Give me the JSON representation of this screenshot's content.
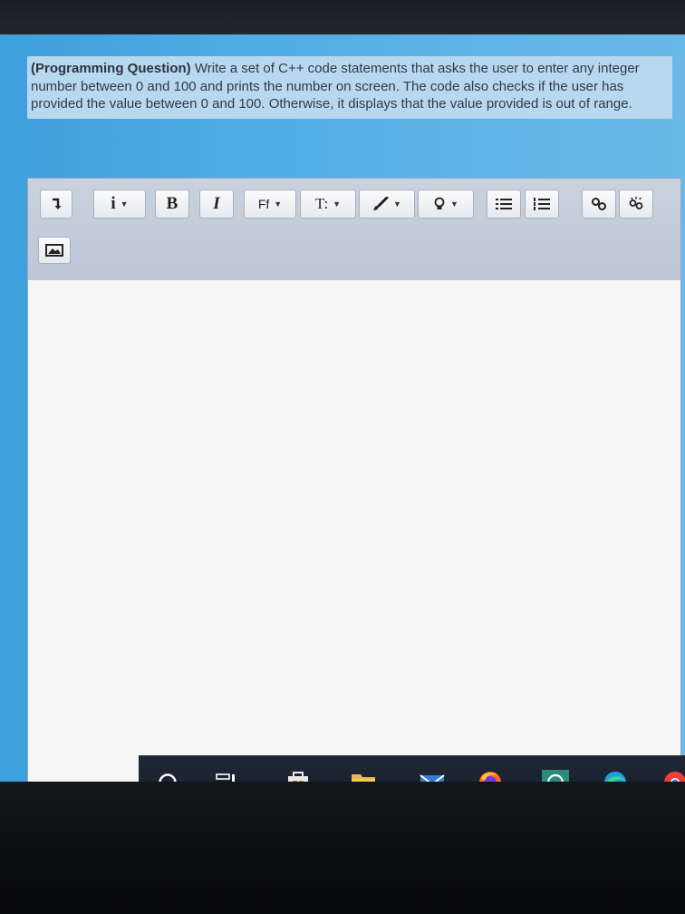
{
  "question": {
    "lead": "(Programming Question)",
    "text": " Write a set of C++ code statements that asks the user to enter any integer number between 0 and 100 and prints the number on screen. The code also checks if the user has provided the value between 0 and 100. Otherwise, it displays that the value provided is out of range."
  },
  "toolbar": {
    "paragraph_label": "i",
    "bold_label": "B",
    "italic_label": "I",
    "font_family_label": "Ff",
    "font_size_label": "T:"
  },
  "editor": {
    "content": ""
  },
  "colors": {
    "screen_blue": "#4ea8e0",
    "toolbar_bg": "#c3ccda",
    "taskbar_bg": "#1c2431",
    "editor_bg": "#f5f5f5"
  },
  "taskbar": {
    "icons": [
      "search-circle-icon",
      "task-view-icon",
      "store-icon",
      "file-explorer-icon",
      "mail-icon",
      "firefox-icon",
      "whatsapp-icon",
      "edge-icon",
      "chrome-icon"
    ]
  }
}
